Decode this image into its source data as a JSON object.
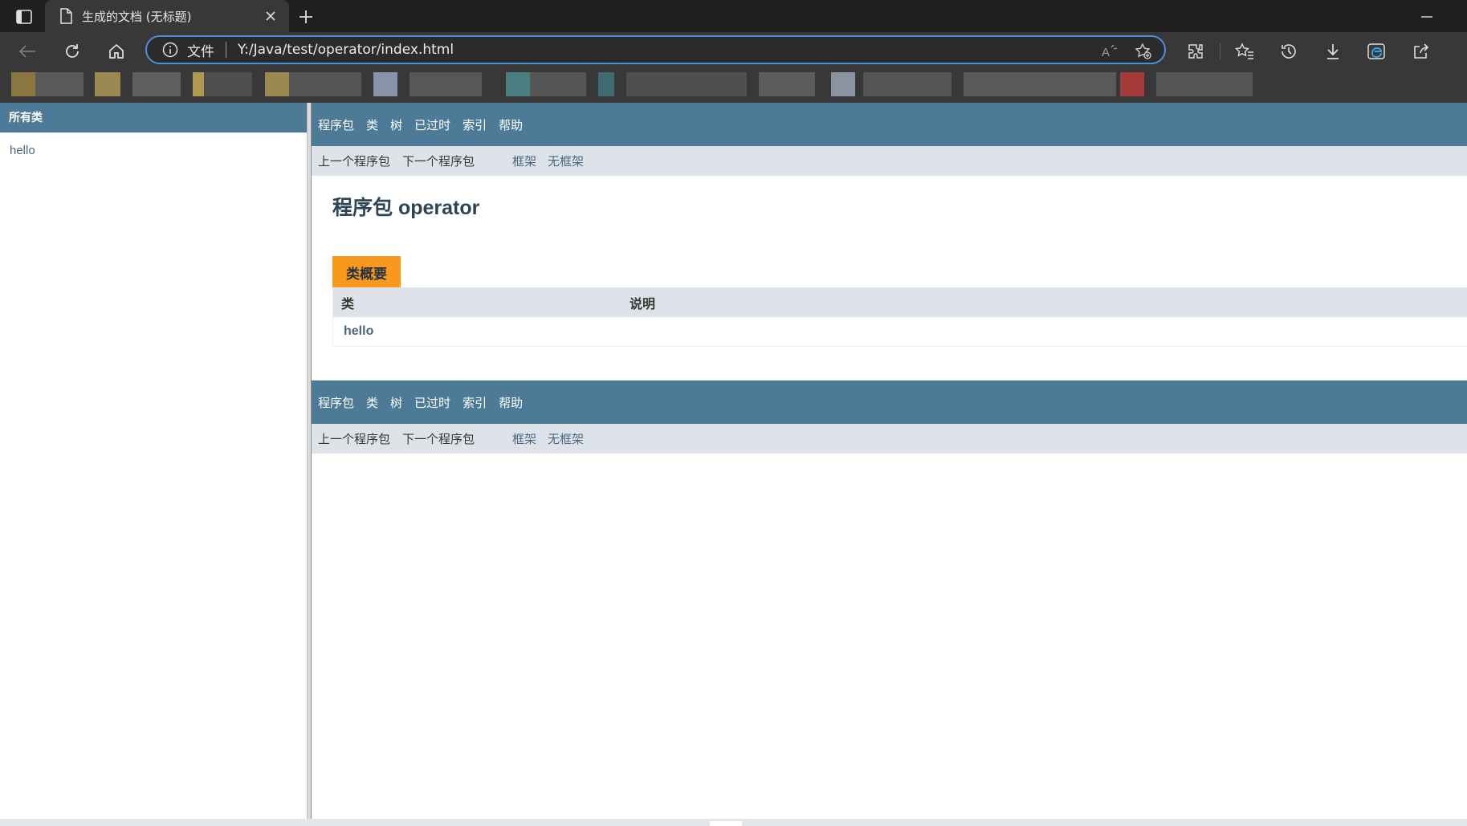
{
  "browser": {
    "tab_title": "生成的文档 (无标题)",
    "address_scheme": "文件",
    "address_url": "Y:/Java/test/operator/index.html"
  },
  "left_frame": {
    "header": "所有类",
    "classes": [
      "hello"
    ]
  },
  "right_frame": {
    "top_nav": [
      "程序包",
      "类",
      "树",
      "已过时",
      "索引",
      "帮助"
    ],
    "subnav": {
      "prev": "上一个程序包",
      "next": "下一个程序包",
      "frames": "框架",
      "no_frames": "无框架"
    },
    "package_title": "程序包 operator",
    "summary": {
      "tab_label": "类概要",
      "columns": [
        "类",
        "说明"
      ],
      "rows": [
        {
          "name": "hello",
          "description": ""
        }
      ]
    }
  },
  "colors": {
    "nav_bar": "#4d7a97",
    "subnav": "#dee3e9",
    "summary_tab": "#f8981d",
    "link": "#4a6782",
    "chrome_dark": "#1f1f1f",
    "chrome_toolbar": "#383838",
    "address_focus": "#4a90d6"
  },
  "icons": {
    "tab_actions": "tab-actions-icon",
    "document": "document-icon",
    "close": "close-icon",
    "new_tab": "plus-icon",
    "minimize": "minimize-icon",
    "back": "back-arrow-icon",
    "refresh": "refresh-icon",
    "home": "home-icon",
    "info": "info-icon",
    "read_aloud": "read-aloud-icon",
    "add_favorite": "add-favorite-icon",
    "extensions": "extensions-icon",
    "favorites": "favorites-icon",
    "history": "history-icon",
    "downloads": "download-icon",
    "edge": "edge-icon",
    "share": "share-icon"
  }
}
